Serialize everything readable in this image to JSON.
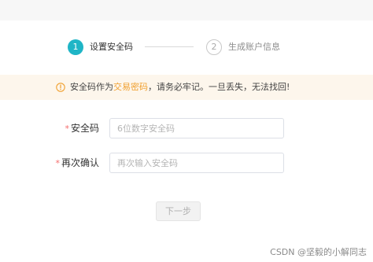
{
  "steps": {
    "step1": {
      "number": "1",
      "label": "设置安全码"
    },
    "step2": {
      "number": "2",
      "label": "生成账户信息"
    }
  },
  "alert": {
    "icon": "warning-circle-icon",
    "text_before": "安全码作为",
    "text_highlight": "交易密码",
    "text_after": "，请务必牢记。一旦丢失，无法找回!",
    "highlight_color": "#f0a030"
  },
  "form": {
    "security_code": {
      "required_mark": "*",
      "label": "安全码",
      "placeholder": "6位数字安全码",
      "value": ""
    },
    "confirm_code": {
      "required_mark": "*",
      "label": "再次确认",
      "placeholder": "再次输入安全码",
      "value": ""
    }
  },
  "actions": {
    "next_label": "下一步"
  },
  "watermark": "CSDN @坚毅的小解同志",
  "colors": {
    "accent": "#1fb5c6",
    "required": "#f56c6c",
    "alert_bg": "#fdf6ec"
  }
}
